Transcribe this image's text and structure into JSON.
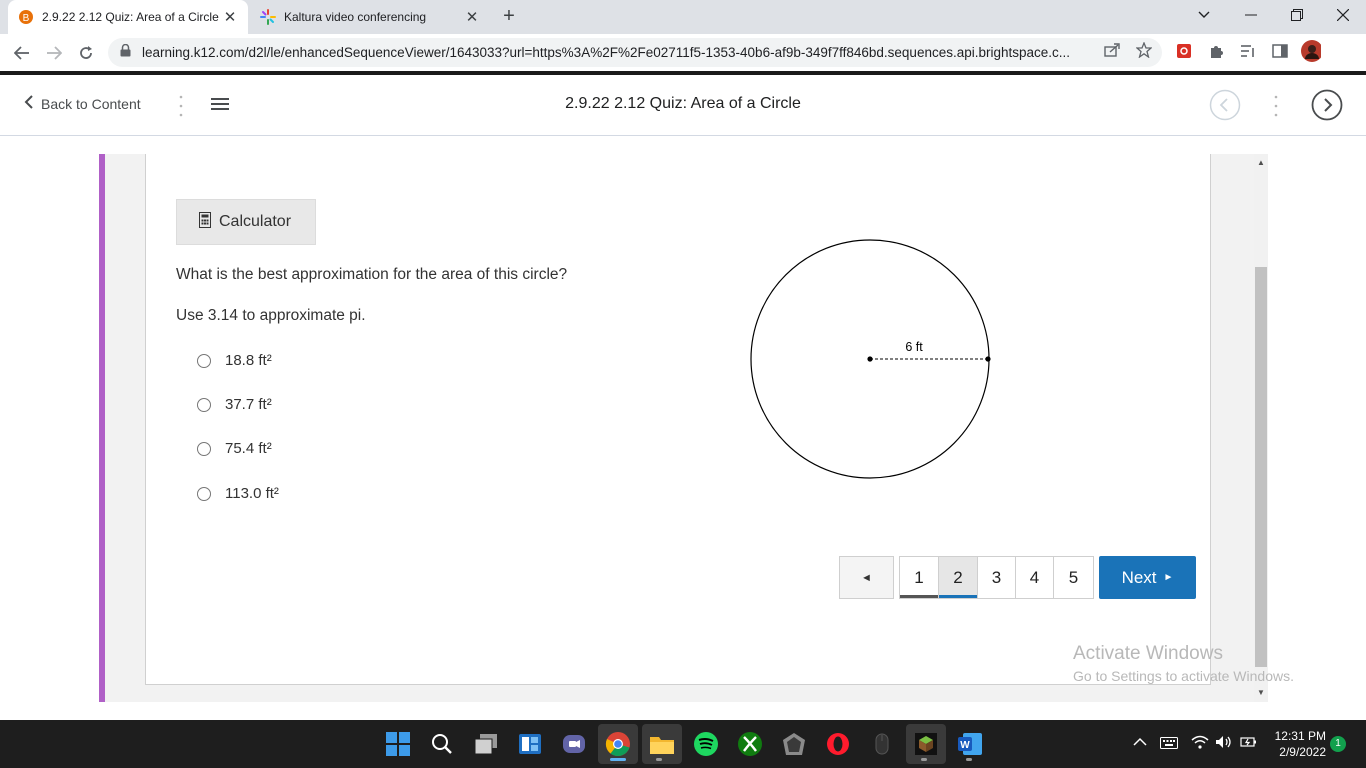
{
  "browser": {
    "tabs": [
      {
        "title": "2.9.22 2.12 Quiz: Area of a Circle",
        "active": true
      },
      {
        "title": "Kaltura video conferencing",
        "active": false
      }
    ],
    "new_tab_symbol": "+",
    "url": "learning.k12.com/d2l/le/enhancedSequenceViewer/1643033?url=https%3A%2F%2Fe02711f5-1353-40b6-af9b-349f7ff846bd.sequences.api.brightspace.c...",
    "accent_color": "#1a73b8"
  },
  "navbar": {
    "back_label": "Back to Content",
    "title": "2.9.22 2.12 Quiz: Area of a Circle"
  },
  "quiz": {
    "calculator_label": "Calculator",
    "question": "What is the best approximation for the area of this circle?",
    "hint": "Use 3.14 to approximate pi.",
    "options": [
      "18.8 ft²",
      "37.7 ft²",
      "75.4 ft²",
      "113.0 ft²"
    ],
    "figure": {
      "radius_label": "6 ft"
    }
  },
  "pagination": {
    "prev_symbol": "◄",
    "pages": [
      "1",
      "2",
      "3",
      "4",
      "5"
    ],
    "current_page": "2",
    "next_label": "Next",
    "next_symbol": "►"
  },
  "watermark": {
    "line1": "Activate Windows",
    "line2": "Go to Settings to activate Windows."
  },
  "taskbar": {
    "time": "12:31 PM",
    "date": "2/9/2022",
    "notification_count": "1"
  }
}
